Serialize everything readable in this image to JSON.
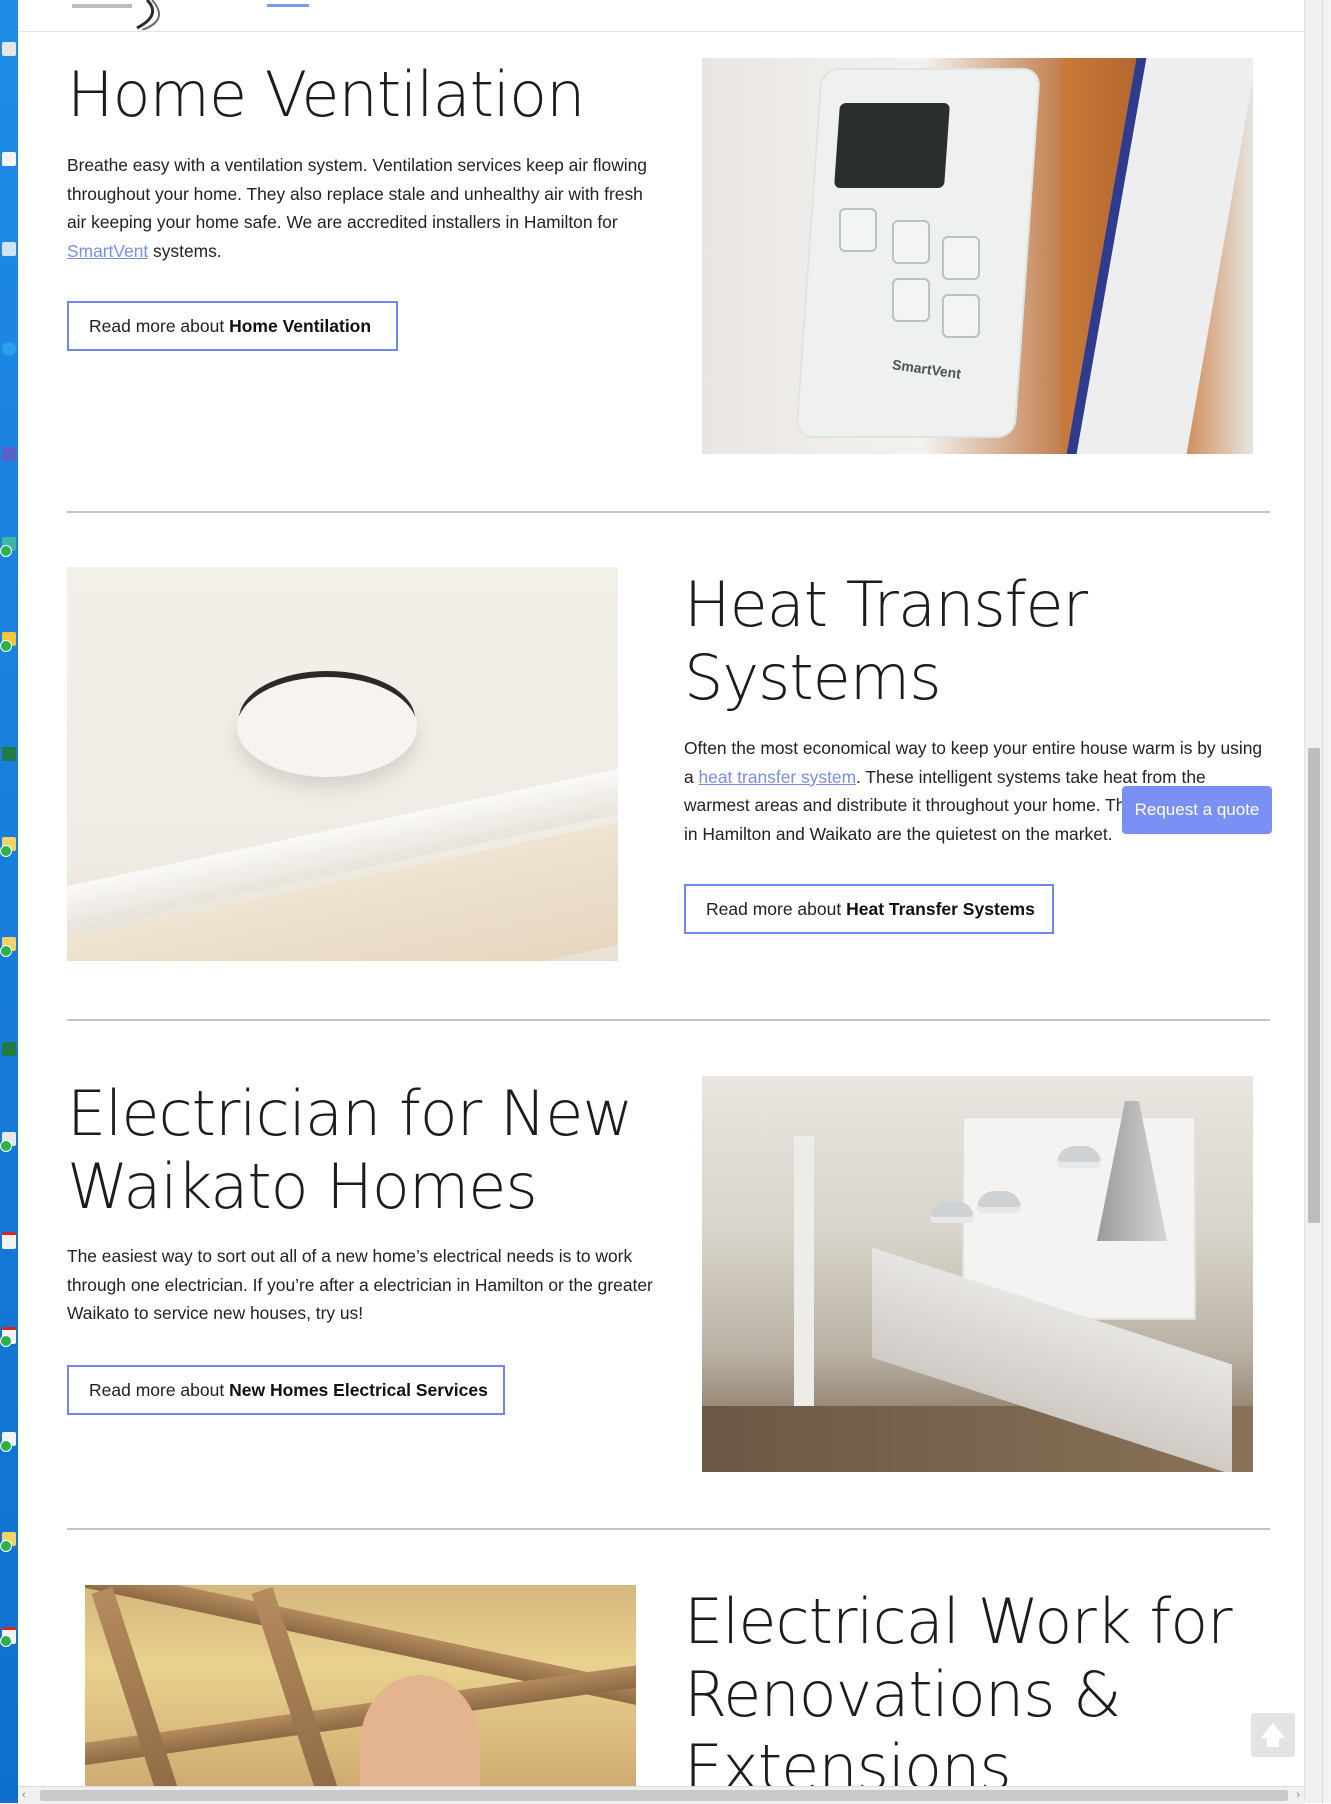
{
  "sections": {
    "ventilation": {
      "heading": "Home Ventilation",
      "para_before_link": "Breathe easy with a ventilation system. Ventilation services keep air flowing throughout your home. They also replace stale and unhealthy air with fresh air keeping your home safe. We are accredited installers in Hamilton for ",
      "link": "SmartVent",
      "para_after_link": " systems.",
      "button_prefix": "Read more about ",
      "button_strong": "Home Ventilation",
      "image_brand": "SmartVent"
    },
    "heat": {
      "heading_line1": "Heat Transfer",
      "heading_line2": "Systems",
      "para_before_link": "Often the most economical way to keep your entire house warm is by using a ",
      "link": "heat transfer system",
      "para_after_link": ". These intelligent systems take heat from the warmest areas and distribute it throughout your home. The systems we offer in Hamilton and Waikato are the quietest on the market.",
      "button_prefix": "Read more about ",
      "button_strong": "Heat Transfer Systems"
    },
    "new_homes": {
      "heading_line1": "Electrician for New",
      "heading_line2": "Waikato Homes",
      "para": "The easiest way to sort out all of a new home’s electrical needs is to work through one electrician. If you’re after a electrician in Hamilton or the greater Waikato to service new houses, try us!",
      "button_prefix": "Read more about ",
      "button_strong": "New Homes Electrical Services"
    },
    "renovations": {
      "heading_line1": "Electrical Work for",
      "heading_line2": "Renovations &",
      "heading_line3": "Extensions"
    }
  },
  "floating": {
    "quote_label": "Request a quote",
    "to_top_glyph": "🡅"
  },
  "scroll": {
    "left_arrow": "‹",
    "right_arrow": "›"
  },
  "colors": {
    "accent": "#7a90f4",
    "link": "#7a8ee8",
    "button_border": "#6e86ee"
  }
}
